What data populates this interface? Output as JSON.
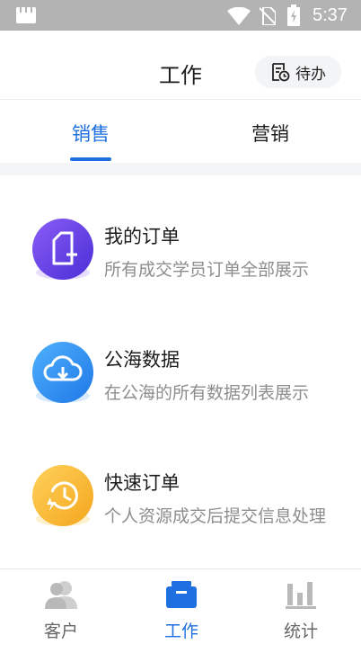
{
  "status_bar": {
    "time": "5:37",
    "icons": [
      "app-icon",
      "wifi-icon",
      "no-sim-icon",
      "battery-charging-icon"
    ]
  },
  "header": {
    "title": "工作",
    "todo_label": "待办",
    "todo_icon": "todo-list-icon"
  },
  "tabs": [
    {
      "label": "销售",
      "active": true
    },
    {
      "label": "营销",
      "active": false
    }
  ],
  "items": [
    {
      "title": "我的订单",
      "desc": "所有成交学员订单全部展示",
      "icon": "add-document-icon",
      "color": "#6a3ee8"
    },
    {
      "title": "公海数据",
      "desc": "在公海的所有数据列表展示",
      "icon": "cloud-download-icon",
      "color": "#2f8ef0"
    },
    {
      "title": "快速订单",
      "desc": "个人资源成交后提交信息处理",
      "icon": "clock-flash-icon",
      "color": "#f7b52c"
    }
  ],
  "bottom_nav": [
    {
      "label": "客户",
      "icon": "people-icon",
      "active": false
    },
    {
      "label": "工作",
      "icon": "briefcase-icon",
      "active": true
    },
    {
      "label": "统计",
      "icon": "bar-chart-icon",
      "active": false
    }
  ],
  "colors": {
    "accent": "#1f6fe0",
    "status_bar": "#b3b3b3"
  }
}
